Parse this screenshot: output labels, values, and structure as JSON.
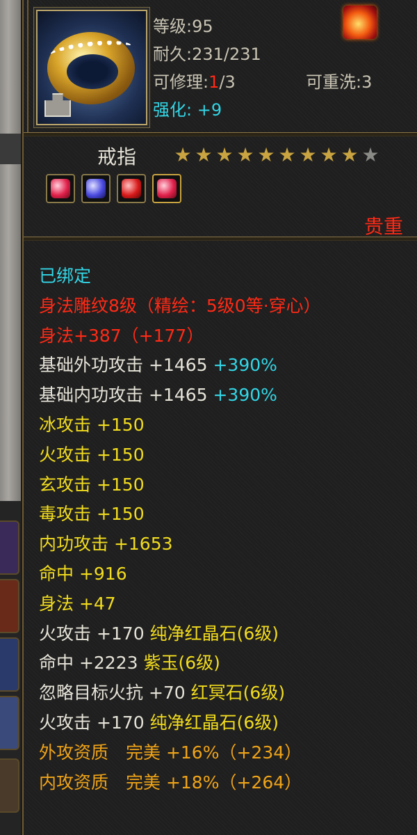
{
  "item": {
    "level_label": "等级:",
    "level_value": "95",
    "durability_label": "耐久:",
    "durability_value": "231/231",
    "repair_label": "可修理:",
    "repair_used": "1",
    "repair_total": "/3",
    "rewash_label": "可重洗:",
    "rewash_value": "3",
    "enhance_label": "强化:",
    "enhance_value": "+9",
    "name": "戒指",
    "stars_total": 10,
    "stars_filled": 9,
    "star_glyph": "★",
    "rarity": "贵重",
    "icon": "gold-ring-icon",
    "gem_sockets": [
      "red-gem-icon",
      "blue-gem-icon",
      "red-crystal-icon",
      "red-gem-icon"
    ]
  },
  "colors": {
    "cyan": "#33d6e6",
    "red": "#ff2a16",
    "yellow": "#f2dc1e",
    "orange": "#f0a418",
    "white": "#e6e3d8"
  },
  "attributes": {
    "bound": "已绑定",
    "engrave": "身法雕纹8级（精绘：5级0等·穿心）",
    "agility_main": "身法+387（+177）",
    "base_ext_atk": "基础外功攻击 +1465",
    "base_ext_pct": "+390%",
    "base_int_atk": "基础内功攻击 +1465",
    "base_int_pct": "+390%",
    "ice_atk": "冰攻击 +150",
    "fire_atk": "火攻击 +150",
    "mystic_atk": "玄攻击 +150",
    "poison_atk": "毒攻击 +150",
    "int_atk": "内功攻击 +1653",
    "hit": "命中 +916",
    "agility": "身法 +47",
    "gem1_stat": "火攻击 +170",
    "gem1_name": "纯净红晶石(6级)",
    "gem2_stat": "命中 +2223",
    "gem2_name": "紫玉(6级)",
    "gem3_stat": "忽略目标火抗 +70",
    "gem3_name": "红冥石(6级)",
    "gem4_stat": "火攻击 +170",
    "gem4_name": "纯净红晶石(6级)",
    "ext_aptitude": "外攻资质　完美 +16%（+234）",
    "int_aptitude": "内攻资质　完美 +18%（+264）"
  }
}
